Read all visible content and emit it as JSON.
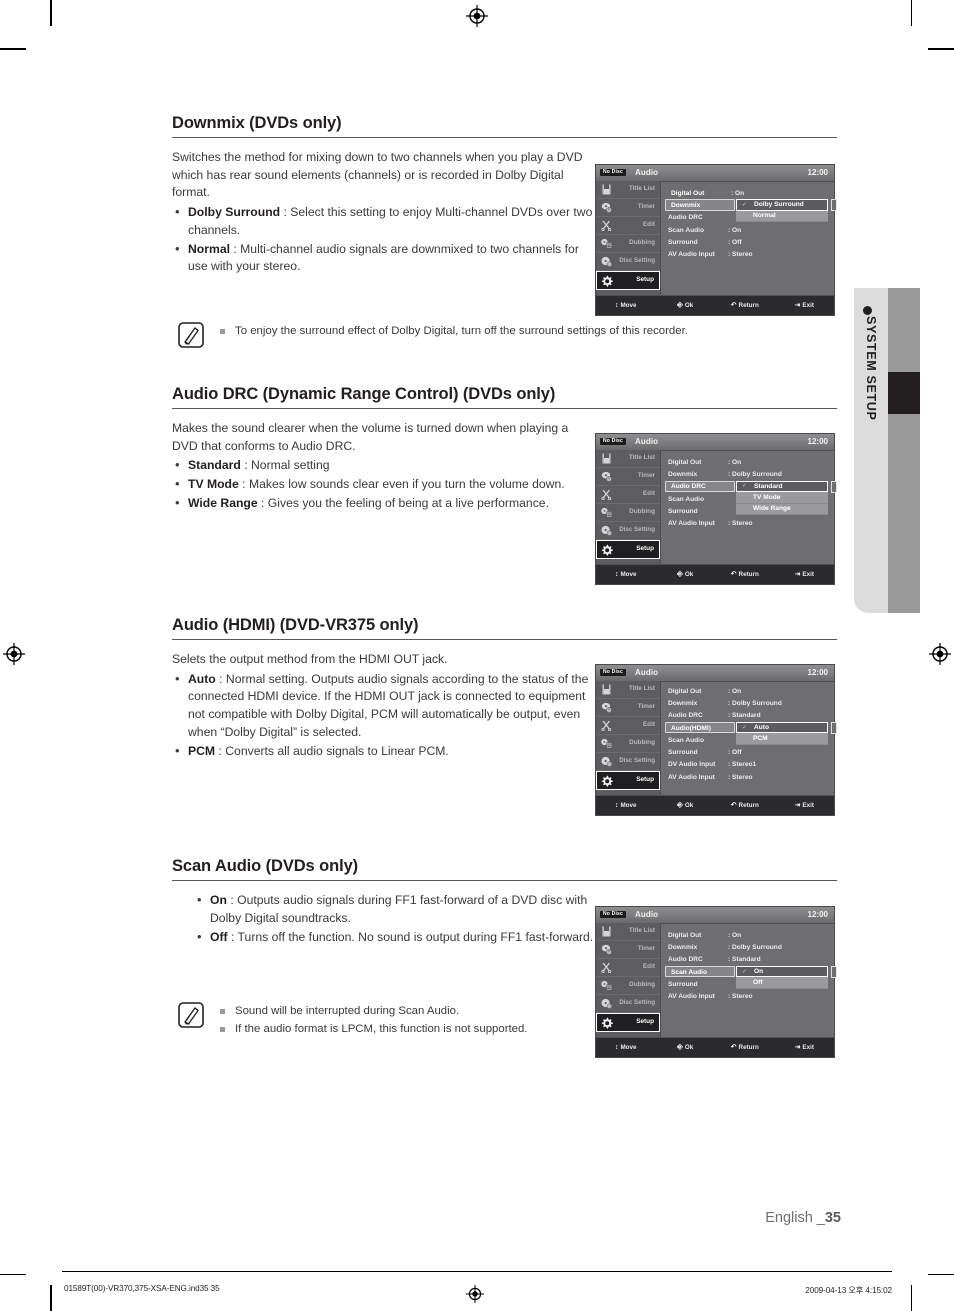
{
  "page": {
    "language_label": "English _",
    "page_number": "35",
    "side_tab_label": "SYSTEM SETUP",
    "footer_file": "01589T(00)-VR370,375-XSA-ENG.ind35   35",
    "footer_date": "2009-04-13   오후 4:15:02"
  },
  "sections": [
    {
      "title": "Downmix (DVDs only)",
      "intro": "Switches the method for mixing down to two channels when you play a DVD which has rear sound elements (channels) or is recorded in Dolby Digital format.",
      "bullets": [
        {
          "term": "Dolby Surround",
          "text": " : Select this setting to enjoy Multi-channel DVDs over two channels."
        },
        {
          "term": "Normal",
          "text": " : Multi-channel audio signals are downmixed to two channels for use with your stereo."
        }
      ],
      "notes": [
        "To enjoy the surround effect of Dolby Digital, turn off the surround settings of this recorder."
      ]
    },
    {
      "title": "Audio DRC (Dynamic Range Control) (DVDs only)",
      "intro": "Makes the sound clearer when the volume is turned down when playing a DVD that conforms to Audio DRC.",
      "bullets": [
        {
          "term": "Standard",
          "text": " : Normal setting"
        },
        {
          "term": "TV Mode",
          "text": " : Makes low sounds clear even if you turn the volume down."
        },
        {
          "term": "Wide Range",
          "text": " : Gives you the feeling of being at a live performance."
        }
      ],
      "notes": []
    },
    {
      "title": "Audio (HDMI) (DVD-VR375 only)",
      "intro": "Selets the output method from the HDMI OUT jack.",
      "bullets": [
        {
          "term": "Auto",
          "text": " : Normal setting. Outputs audio signals according to the status of the connected HDMI device. If the HDMI OUT jack is connected to equipment not compatible with Dolby Digital, PCM will automatically be output, even when “Dolby Digital” is selected."
        },
        {
          "term": "PCM",
          "text": " : Converts all audio signals to Linear PCM."
        }
      ],
      "notes": []
    },
    {
      "title": "Scan Audio (DVDs only)",
      "intro": "",
      "bullets": [
        {
          "term": "On",
          "text": " : Outputs audio signals during FF1 fast-forward of a DVD disc with Dolby Digital soundtracks."
        },
        {
          "term": "Off",
          "text": " : Turns off the function. No sound is output during FF1 fast-forward."
        }
      ],
      "notes": [
        "Sound will be interrupted during Scan Audio.",
        "If the audio format is LPCM, this function is not supported."
      ]
    }
  ],
  "osd_common": {
    "disc_badge": "No Disc",
    "title": "Audio",
    "clock": "12:00",
    "sidebar": [
      {
        "label": "Title List",
        "icon": "title-list-icon"
      },
      {
        "label": "Timer",
        "icon": "timer-icon"
      },
      {
        "label": "Edit",
        "icon": "edit-scissors-icon"
      },
      {
        "label": "Dubbing",
        "icon": "dubbing-icon"
      },
      {
        "label": "Disc Setting",
        "icon": "disc-setting-icon"
      },
      {
        "label": "Setup",
        "icon": "setup-gear-icon"
      }
    ],
    "footer": [
      {
        "icon": "up-down-arrow-icon",
        "label": "Move"
      },
      {
        "icon": "ok-button-icon",
        "label": "Ok"
      },
      {
        "icon": "return-arrow-icon",
        "label": "Return"
      },
      {
        "icon": "exit-icon",
        "label": "Exit"
      }
    ]
  },
  "osd_screens": [
    {
      "id": "downmix",
      "rows": [
        {
          "label": "Digital Out",
          "value": ": On",
          "selected": false
        },
        {
          "label": "Downmix",
          "value": "",
          "selected": true
        },
        {
          "label": "Audio DRC",
          "value": "",
          "selected": false
        },
        {
          "label": "Scan Audio",
          "value": ": On",
          "selected": false
        },
        {
          "label": "Surround",
          "value": ": Off",
          "selected": false
        },
        {
          "label": "AV Audio Input",
          "value": ": Stereo",
          "selected": false
        }
      ],
      "dropdown": {
        "row_index": 1,
        "options": [
          "Dolby Surround",
          "Normal"
        ],
        "current": "Dolby Surround"
      }
    },
    {
      "id": "audio-drc",
      "rows": [
        {
          "label": "Digital Out",
          "value": ": On",
          "selected": false
        },
        {
          "label": "Downmix",
          "value": ": Dolby Surround",
          "selected": false
        },
        {
          "label": "Audio DRC",
          "value": "",
          "selected": true
        },
        {
          "label": "Scan Audio",
          "value": "",
          "selected": false
        },
        {
          "label": "Surround",
          "value": "",
          "selected": false
        },
        {
          "label": "AV Audio Input",
          "value": ": Stereo",
          "selected": false
        }
      ],
      "dropdown": {
        "row_index": 2,
        "options": [
          "Standard",
          "TV Mode",
          "Wide Range"
        ],
        "current": "Standard"
      }
    },
    {
      "id": "audio-hdmi",
      "rows": [
        {
          "label": "Digital Out",
          "value": ": On",
          "selected": false
        },
        {
          "label": "Downmix",
          "value": ": Dolby Surround",
          "selected": false
        },
        {
          "label": "Audio DRC",
          "value": ": Standard",
          "selected": false
        },
        {
          "label": "Audio(HDMI)",
          "value": "",
          "selected": true
        },
        {
          "label": "Scan Audio",
          "value": "",
          "selected": false
        },
        {
          "label": "Surround",
          "value": ": Off",
          "selected": false
        },
        {
          "label": "DV Audio Input",
          "value": ": Stereo1",
          "selected": false
        },
        {
          "label": "AV Audio Input",
          "value": ": Stereo",
          "selected": false
        }
      ],
      "dropdown": {
        "row_index": 3,
        "options": [
          "Auto",
          "PCM"
        ],
        "current": "Auto"
      }
    },
    {
      "id": "scan-audio",
      "rows": [
        {
          "label": "Digital Out",
          "value": ": On",
          "selected": false
        },
        {
          "label": "Downmix",
          "value": ": Dolby Surround",
          "selected": false
        },
        {
          "label": "Audio DRC",
          "value": ": Standard",
          "selected": false
        },
        {
          "label": "Scan Audio",
          "value": "",
          "selected": true
        },
        {
          "label": "Surround",
          "value": "",
          "selected": false
        },
        {
          "label": "AV Audio Input",
          "value": ": Stereo",
          "selected": false
        }
      ],
      "dropdown": {
        "row_index": 3,
        "options": [
          "On",
          "Off"
        ],
        "current": "On"
      }
    }
  ]
}
